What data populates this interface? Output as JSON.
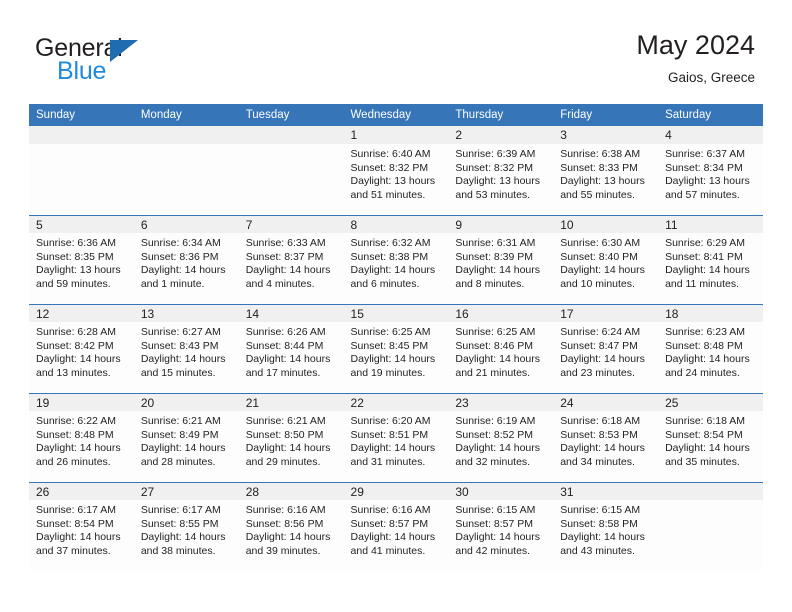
{
  "brand": {
    "name_top": "General",
    "name_bottom": "Blue",
    "triangle_color": "#1f6cb0",
    "blue_color": "#1f8ae0"
  },
  "header": {
    "title": "May 2024",
    "subtitle": "Gaios, Greece",
    "header_bg": "#3575b8",
    "daynum_bg": "#f0f0f0"
  },
  "weekday_headers": [
    "Sunday",
    "Monday",
    "Tuesday",
    "Wednesday",
    "Thursday",
    "Friday",
    "Saturday"
  ],
  "weeks": [
    [
      {
        "day": "",
        "lines": []
      },
      {
        "day": "",
        "lines": []
      },
      {
        "day": "",
        "lines": []
      },
      {
        "day": "1",
        "lines": [
          "Sunrise: 6:40 AM",
          "Sunset: 8:32 PM",
          "Daylight: 13 hours",
          "and 51 minutes."
        ]
      },
      {
        "day": "2",
        "lines": [
          "Sunrise: 6:39 AM",
          "Sunset: 8:32 PM",
          "Daylight: 13 hours",
          "and 53 minutes."
        ]
      },
      {
        "day": "3",
        "lines": [
          "Sunrise: 6:38 AM",
          "Sunset: 8:33 PM",
          "Daylight: 13 hours",
          "and 55 minutes."
        ]
      },
      {
        "day": "4",
        "lines": [
          "Sunrise: 6:37 AM",
          "Sunset: 8:34 PM",
          "Daylight: 13 hours",
          "and 57 minutes."
        ]
      }
    ],
    [
      {
        "day": "5",
        "lines": [
          "Sunrise: 6:36 AM",
          "Sunset: 8:35 PM",
          "Daylight: 13 hours",
          "and 59 minutes."
        ]
      },
      {
        "day": "6",
        "lines": [
          "Sunrise: 6:34 AM",
          "Sunset: 8:36 PM",
          "Daylight: 14 hours",
          "and 1 minute."
        ]
      },
      {
        "day": "7",
        "lines": [
          "Sunrise: 6:33 AM",
          "Sunset: 8:37 PM",
          "Daylight: 14 hours",
          "and 4 minutes."
        ]
      },
      {
        "day": "8",
        "lines": [
          "Sunrise: 6:32 AM",
          "Sunset: 8:38 PM",
          "Daylight: 14 hours",
          "and 6 minutes."
        ]
      },
      {
        "day": "9",
        "lines": [
          "Sunrise: 6:31 AM",
          "Sunset: 8:39 PM",
          "Daylight: 14 hours",
          "and 8 minutes."
        ]
      },
      {
        "day": "10",
        "lines": [
          "Sunrise: 6:30 AM",
          "Sunset: 8:40 PM",
          "Daylight: 14 hours",
          "and 10 minutes."
        ]
      },
      {
        "day": "11",
        "lines": [
          "Sunrise: 6:29 AM",
          "Sunset: 8:41 PM",
          "Daylight: 14 hours",
          "and 11 minutes."
        ]
      }
    ],
    [
      {
        "day": "12",
        "lines": [
          "Sunrise: 6:28 AM",
          "Sunset: 8:42 PM",
          "Daylight: 14 hours",
          "and 13 minutes."
        ]
      },
      {
        "day": "13",
        "lines": [
          "Sunrise: 6:27 AM",
          "Sunset: 8:43 PM",
          "Daylight: 14 hours",
          "and 15 minutes."
        ]
      },
      {
        "day": "14",
        "lines": [
          "Sunrise: 6:26 AM",
          "Sunset: 8:44 PM",
          "Daylight: 14 hours",
          "and 17 minutes."
        ]
      },
      {
        "day": "15",
        "lines": [
          "Sunrise: 6:25 AM",
          "Sunset: 8:45 PM",
          "Daylight: 14 hours",
          "and 19 minutes."
        ]
      },
      {
        "day": "16",
        "lines": [
          "Sunrise: 6:25 AM",
          "Sunset: 8:46 PM",
          "Daylight: 14 hours",
          "and 21 minutes."
        ]
      },
      {
        "day": "17",
        "lines": [
          "Sunrise: 6:24 AM",
          "Sunset: 8:47 PM",
          "Daylight: 14 hours",
          "and 23 minutes."
        ]
      },
      {
        "day": "18",
        "lines": [
          "Sunrise: 6:23 AM",
          "Sunset: 8:48 PM",
          "Daylight: 14 hours",
          "and 24 minutes."
        ]
      }
    ],
    [
      {
        "day": "19",
        "lines": [
          "Sunrise: 6:22 AM",
          "Sunset: 8:48 PM",
          "Daylight: 14 hours",
          "and 26 minutes."
        ]
      },
      {
        "day": "20",
        "lines": [
          "Sunrise: 6:21 AM",
          "Sunset: 8:49 PM",
          "Daylight: 14 hours",
          "and 28 minutes."
        ]
      },
      {
        "day": "21",
        "lines": [
          "Sunrise: 6:21 AM",
          "Sunset: 8:50 PM",
          "Daylight: 14 hours",
          "and 29 minutes."
        ]
      },
      {
        "day": "22",
        "lines": [
          "Sunrise: 6:20 AM",
          "Sunset: 8:51 PM",
          "Daylight: 14 hours",
          "and 31 minutes."
        ]
      },
      {
        "day": "23",
        "lines": [
          "Sunrise: 6:19 AM",
          "Sunset: 8:52 PM",
          "Daylight: 14 hours",
          "and 32 minutes."
        ]
      },
      {
        "day": "24",
        "lines": [
          "Sunrise: 6:18 AM",
          "Sunset: 8:53 PM",
          "Daylight: 14 hours",
          "and 34 minutes."
        ]
      },
      {
        "day": "25",
        "lines": [
          "Sunrise: 6:18 AM",
          "Sunset: 8:54 PM",
          "Daylight: 14 hours",
          "and 35 minutes."
        ]
      }
    ],
    [
      {
        "day": "26",
        "lines": [
          "Sunrise: 6:17 AM",
          "Sunset: 8:54 PM",
          "Daylight: 14 hours",
          "and 37 minutes."
        ]
      },
      {
        "day": "27",
        "lines": [
          "Sunrise: 6:17 AM",
          "Sunset: 8:55 PM",
          "Daylight: 14 hours",
          "and 38 minutes."
        ]
      },
      {
        "day": "28",
        "lines": [
          "Sunrise: 6:16 AM",
          "Sunset: 8:56 PM",
          "Daylight: 14 hours",
          "and 39 minutes."
        ]
      },
      {
        "day": "29",
        "lines": [
          "Sunrise: 6:16 AM",
          "Sunset: 8:57 PM",
          "Daylight: 14 hours",
          "and 41 minutes."
        ]
      },
      {
        "day": "30",
        "lines": [
          "Sunrise: 6:15 AM",
          "Sunset: 8:57 PM",
          "Daylight: 14 hours",
          "and 42 minutes."
        ]
      },
      {
        "day": "31",
        "lines": [
          "Sunrise: 6:15 AM",
          "Sunset: 8:58 PM",
          "Daylight: 14 hours",
          "and 43 minutes."
        ]
      },
      {
        "day": "",
        "lines": []
      }
    ]
  ]
}
